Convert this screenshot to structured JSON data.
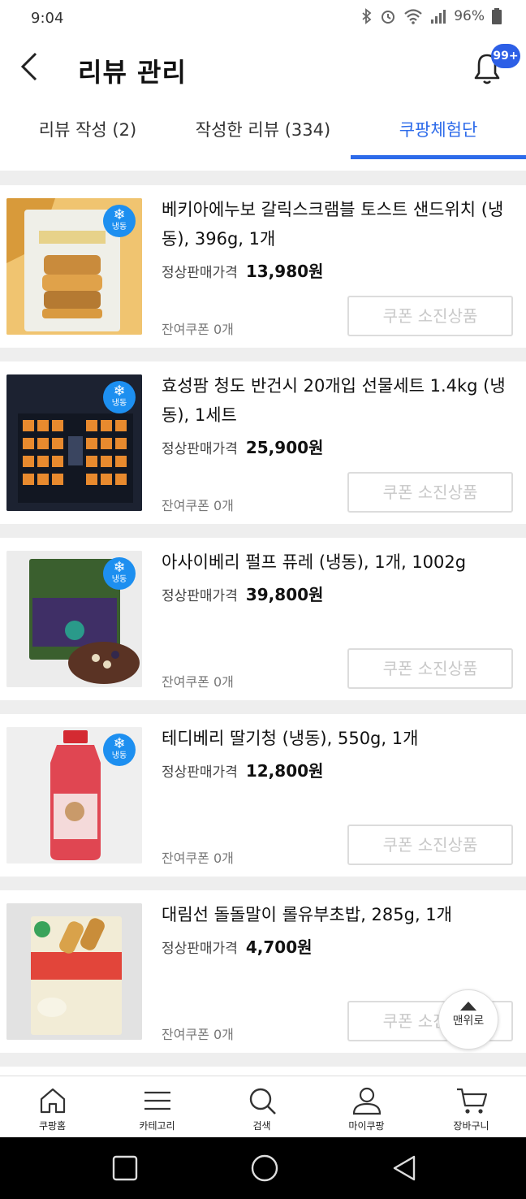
{
  "status_bar": {
    "time": "9:04",
    "battery": "96%"
  },
  "header": {
    "title": "리뷰 관리",
    "notification_badge": "99+"
  },
  "tabs": [
    {
      "label": "리뷰 작성 (2)",
      "active": false
    },
    {
      "label": "작성한 리뷰 (334)",
      "active": false
    },
    {
      "label": "쿠팡체험단",
      "active": true
    }
  ],
  "accent_color": "#2d6bea",
  "frozen_badge_label": "냉동",
  "products": [
    {
      "name": "베키아에누보 갈릭스크램블 토스트 샌드위치 (냉동), 396g, 1개",
      "price_label": "정상판매가격",
      "price": "13,980원",
      "remaining": "잔여쿠폰 0개",
      "button": "쿠폰 소진상품",
      "thumb_icon": "sandwich-product-image"
    },
    {
      "name": "효성팜 청도 반건시 20개입 선물세트 1.4kg (냉동), 1세트",
      "price_label": "정상판매가격",
      "price": "25,900원",
      "remaining": "잔여쿠폰 0개",
      "button": "쿠폰 소진상품",
      "thumb_icon": "persimmon-gift-set-image"
    },
    {
      "name": "아사이베리 펄프 퓨레 (냉동), 1개, 1002g",
      "price_label": "정상판매가격",
      "price": "39,800원",
      "remaining": "잔여쿠폰 0개",
      "button": "쿠폰 소진상품",
      "thumb_icon": "acai-puree-image"
    },
    {
      "name": "테디베리 딸기청 (냉동), 550g, 1개",
      "price_label": "정상판매가격",
      "price": "12,800원",
      "remaining": "잔여쿠폰 0개",
      "button": "쿠폰 소진상품",
      "thumb_icon": "strawberry-syrup-bottle-image"
    },
    {
      "name": "대림선 돌돌말이 롤유부초밥, 285g, 1개",
      "price_label": "정상판매가격",
      "price": "4,700원",
      "remaining": "잔여쿠폰 0개",
      "button": "쿠폰 소진상품",
      "thumb_icon": "rolled-yubu-sushi-image"
    }
  ],
  "scroll_top_label": "맨위로",
  "bottom_nav": [
    {
      "label": "쿠팡홈",
      "icon": "home-icon"
    },
    {
      "label": "카테고리",
      "icon": "menu-icon"
    },
    {
      "label": "검색",
      "icon": "search-icon"
    },
    {
      "label": "마이쿠팡",
      "icon": "person-icon"
    },
    {
      "label": "장바구니",
      "icon": "cart-icon"
    }
  ]
}
